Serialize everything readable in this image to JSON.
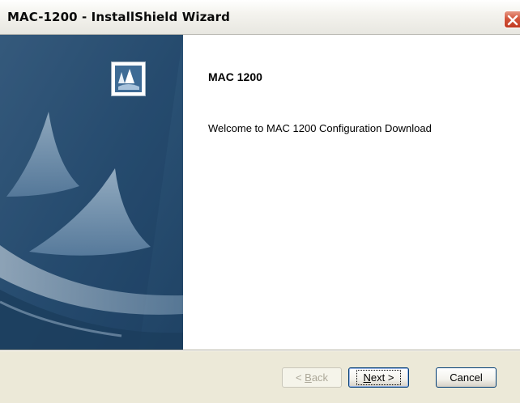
{
  "window": {
    "title": "MAC-1200 - InstallShield Wizard",
    "close_icon": "close-x-icon"
  },
  "sidebar": {
    "logo_icon": "installshield-logo-icon",
    "art": "sailboat-sails-artwork"
  },
  "content": {
    "heading": "MAC 1200",
    "welcome_text": "Welcome to MAC 1200 Configuration Download"
  },
  "buttons": {
    "back_mnemonic": "B",
    "back_rest": "ack",
    "back_prefix": "< ",
    "next_mnemonic": "N",
    "next_rest": "ext >",
    "cancel": "Cancel"
  },
  "colors": {
    "sidebar_blue": "#2a5478",
    "button_border": "#003c74",
    "close_red": "#c13a21"
  }
}
